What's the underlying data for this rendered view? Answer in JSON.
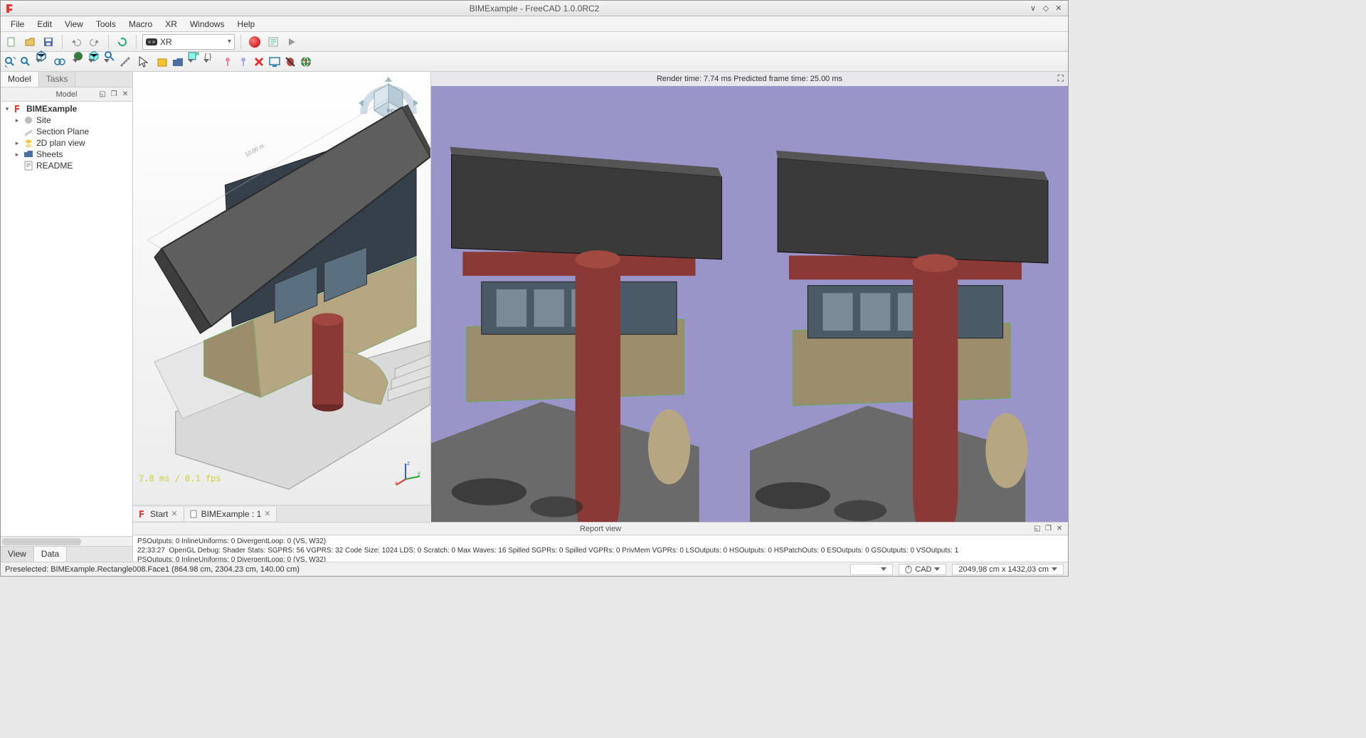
{
  "window": {
    "title": "BIMExample - FreeCAD 1.0.0RC2"
  },
  "menu": {
    "items": [
      "File",
      "Edit",
      "View",
      "Tools",
      "Macro",
      "XR",
      "Windows",
      "Help"
    ]
  },
  "toolbar1": {
    "workbench": "XR",
    "workbench_icon_alt": "VR"
  },
  "leftdock": {
    "tabs": {
      "model": "Model",
      "tasks": "Tasks"
    },
    "header": "Model",
    "bottomtabs": {
      "view": "View",
      "data": "Data"
    }
  },
  "tree": {
    "root": "BIMExample",
    "items": [
      {
        "label": "Site",
        "icon": "globe",
        "expandable": true
      },
      {
        "label": "Section Plane",
        "icon": "plane",
        "expandable": false
      },
      {
        "label": "2D plan view",
        "icon": "layers",
        "expandable": true
      },
      {
        "label": "Sheets",
        "icon": "folder",
        "expandable": true
      },
      {
        "label": "README",
        "icon": "text",
        "expandable": false
      }
    ]
  },
  "view3d": {
    "fps": "7.8 ms / 0.1 fps"
  },
  "vr": {
    "header": "Render time: 7.74 ms Predicted frame time: 25.00 ms"
  },
  "doctabs": {
    "start": "Start",
    "doc": "BIMExample : 1"
  },
  "report": {
    "title": "Report view",
    "lines": [
      "PSOutputs: 0 InlineUniforms: 0 DivergentLoop: 0 (VS, W32)",
      "22:33:27  OpenGL Debug: Shader Stats: SGPRS: 56 VGPRS: 32 Code Size: 1024 LDS: 0 Scratch: 0 Max Waves: 16 Spilled SGPRs: 0 Spilled VGPRs: 0 PrivMem VGPRs: 0 LSOutputs: 0 HSOutputs: 0 HSPatchOuts: 0 ESOutputs: 0 GSOutputs: 0 VSOutputs: 1",
      "PSOutputs: 0 InlineUniforms: 0 DivergentLoop: 0 (VS, W32)"
    ]
  },
  "status": {
    "preselected": "Preselected: BIMExample.Rectangle008.Face1 (864.98 cm, 2304.23 cm, 140.00 cm)",
    "navstyle": "CAD",
    "dims": "2049,98 cm x 1432,03 cm"
  },
  "colors": {
    "accent": "#d8e6f2",
    "vrbg": "#9a95c9",
    "roof": "#5e5e5e",
    "wall": "#35404b",
    "column": "#8a3a36",
    "beige": "#b7a682",
    "ground": "#bdbdbd"
  }
}
